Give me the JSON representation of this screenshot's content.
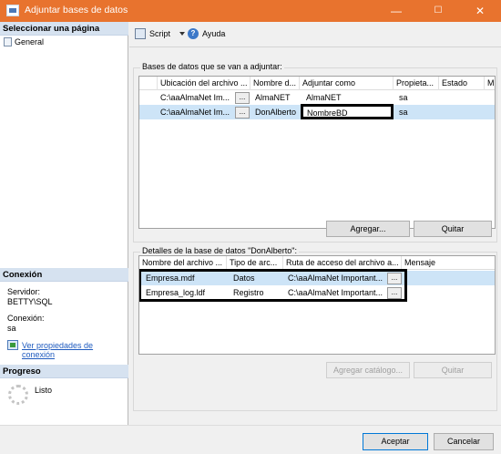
{
  "window": {
    "title": "Adjuntar bases de datos",
    "min": "—",
    "max": "☐",
    "close": "✕"
  },
  "left": {
    "select_page_header": "Seleccionar una página",
    "pages": [
      "General"
    ],
    "connection_header": "Conexión",
    "server_label": "Servidor:",
    "server_value": "BETTY\\SQL",
    "connection_label": "Conexión:",
    "connection_value": "sa",
    "view_props_link": "Ver propiedades de conexión",
    "progress_header": "Progreso",
    "progress_status": "Listo"
  },
  "toolbar": {
    "script_label": "Script",
    "help_label": "Ayuda"
  },
  "databases": {
    "group_label": "Bases de datos que se van a adjuntar:",
    "headers": [
      "Ubicación del archivo ...",
      "Nombre d...",
      "Adjuntar como",
      "Propieta...",
      "Estado",
      "M"
    ],
    "rows": [
      {
        "location": "C:\\aaAlmaNet Im...",
        "dots": "...",
        "name": "AlmaNET",
        "attach_as": "AlmaNET",
        "owner": "sa",
        "status": ""
      },
      {
        "location": "C:\\aaAlmaNet Im...",
        "dots": "...",
        "name": "DonAlberto",
        "attach_as": "NombreBD",
        "owner": "sa",
        "status": ""
      }
    ],
    "add_button": "Agregar...",
    "remove_button": "Quitar"
  },
  "details": {
    "group_label": "Detalles de la base de datos \"DonAlberto\":",
    "headers": [
      "Nombre del archivo ...",
      "Tipo de arc...",
      "Ruta de acceso del archivo a...",
      "Mensaje"
    ],
    "rows": [
      {
        "file": "Empresa.mdf",
        "type": "Datos",
        "path": "C:\\aaAlmaNet Important...",
        "dots": "...",
        "message": ""
      },
      {
        "file": "Empresa_log.ldf",
        "type": "Registro",
        "path": "C:\\aaAlmaNet Important...",
        "dots": "...",
        "message": ""
      }
    ],
    "catalog_button": "Agregar catálogo...",
    "remove_button": "Quitar"
  },
  "footer": {
    "ok_button": "Aceptar",
    "cancel_button": "Cancelar"
  }
}
